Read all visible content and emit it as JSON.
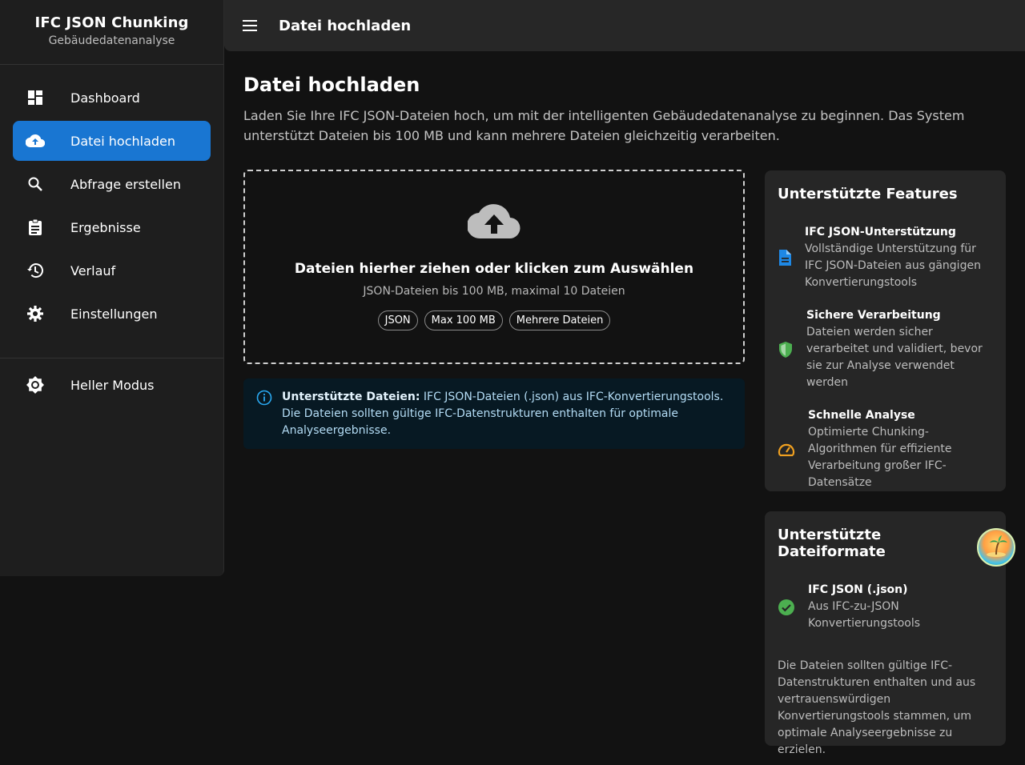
{
  "sidebar": {
    "brand_title": "IFC JSON Chunking",
    "brand_subtitle": "Gebäudedatenanalyse",
    "items": [
      {
        "label": "Dashboard",
        "icon": "dashboard-icon"
      },
      {
        "label": "Datei hochladen",
        "icon": "cloud-upload-icon",
        "active": true
      },
      {
        "label": "Abfrage erstellen",
        "icon": "search-icon"
      },
      {
        "label": "Ergebnisse",
        "icon": "clipboard-icon"
      },
      {
        "label": "Verlauf",
        "icon": "history-icon"
      },
      {
        "label": "Einstellungen",
        "icon": "gear-icon"
      }
    ],
    "theme_toggle": {
      "label": "Heller Modus",
      "icon": "brightness-icon"
    }
  },
  "appbar": {
    "title": "Datei hochladen",
    "menu_icon": "menu-icon"
  },
  "main": {
    "title": "Datei hochladen",
    "description": "Laden Sie Ihre IFC JSON-Dateien hoch, um mit der intelligenten Gebäudedatenanalyse zu beginnen. Das System unterstützt Dateien bis 100 MB und kann mehrere Dateien gleichzeitig verarbeiten.",
    "dropzone": {
      "title": "Dateien hierher ziehen oder klicken zum Auswählen",
      "subtitle": "JSON-Dateien bis 100 MB, maximal 10 Dateien",
      "chips": [
        "JSON",
        "Max 100 MB",
        "Mehrere Dateien"
      ]
    },
    "info": {
      "bold": "Unterstützte Dateien:",
      "text": " IFC JSON-Dateien (.json) aus IFC-Konvertierungstools. Die Dateien sollten gültige IFC-Datenstrukturen enthalten für optimale Analyseergebnisse."
    }
  },
  "features_card": {
    "title": "Unterstützte Features",
    "items": [
      {
        "title": "IFC JSON-Unterstützung",
        "desc": "Vollständige Unterstützung für IFC JSON-Dateien aus gängigen Konvertierungstools",
        "icon": "document-icon",
        "color": "#1976d2"
      },
      {
        "title": "Sichere Verarbeitung",
        "desc": "Dateien werden sicher verarbeitet und validiert, bevor sie zur Analyse verwendet werden",
        "icon": "shield-icon",
        "color": "#4caf50"
      },
      {
        "title": "Schnelle Analyse",
        "desc": "Optimierte Chunking-Algorithmen für effiziente Verarbeitung großer IFC-Datensätze",
        "icon": "speed-icon",
        "color": "#f0a020"
      }
    ]
  },
  "formats_card": {
    "title": "Unterstützte Dateiformate",
    "items": [
      {
        "title": "IFC JSON (.json)",
        "desc": "Aus IFC-zu-JSON Konvertierungstools",
        "icon": "check-circle-icon",
        "color": "#4caf50"
      }
    ],
    "note": "Die Dateien sollten gültige IFC-Datenstrukturen enthalten und aus vertrauenswürdigen Konvertierungstools stammen, um optimale Analyseergebnisse zu erzielen."
  },
  "floating_button": {
    "icon": "palm-island-icon"
  },
  "colors": {
    "accent": "#1976d2",
    "background": "#121212",
    "surface": "#262626",
    "info_bg": "#071923"
  }
}
